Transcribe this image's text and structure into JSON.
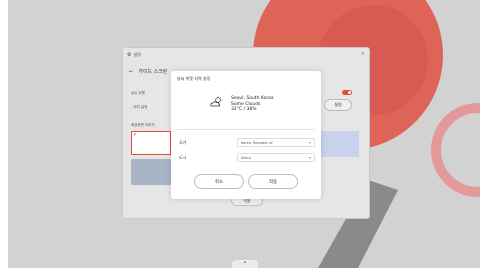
{
  "settings_window": {
    "title": "설정",
    "header": "가이드 스크린",
    "close_glyph": "×",
    "back_glyph": "←",
    "row1_label": "날씨 위젯",
    "row2_label": "- 위치 설정",
    "row3_label": "배경화면 이미지",
    "settings_button": "설정",
    "apply_button": "적용"
  },
  "dialog": {
    "title": "날씨 위젯 지역 설정",
    "weather": {
      "location": "Seoul, South Korea",
      "condition": "Some Clouds",
      "temp": "32°C / 38%"
    },
    "country_label": "국가",
    "country_value": "Korea, Republic of",
    "city_label": "도시",
    "city_value": "Seoul",
    "cancel_button": "취소",
    "ok_button": "적용"
  },
  "dock": {
    "handle_glyph": "⌃"
  },
  "colors": {
    "accent": "#e44c3b",
    "wallpaper": "#d2d2d2",
    "dialog_bg": "#ffffff"
  }
}
